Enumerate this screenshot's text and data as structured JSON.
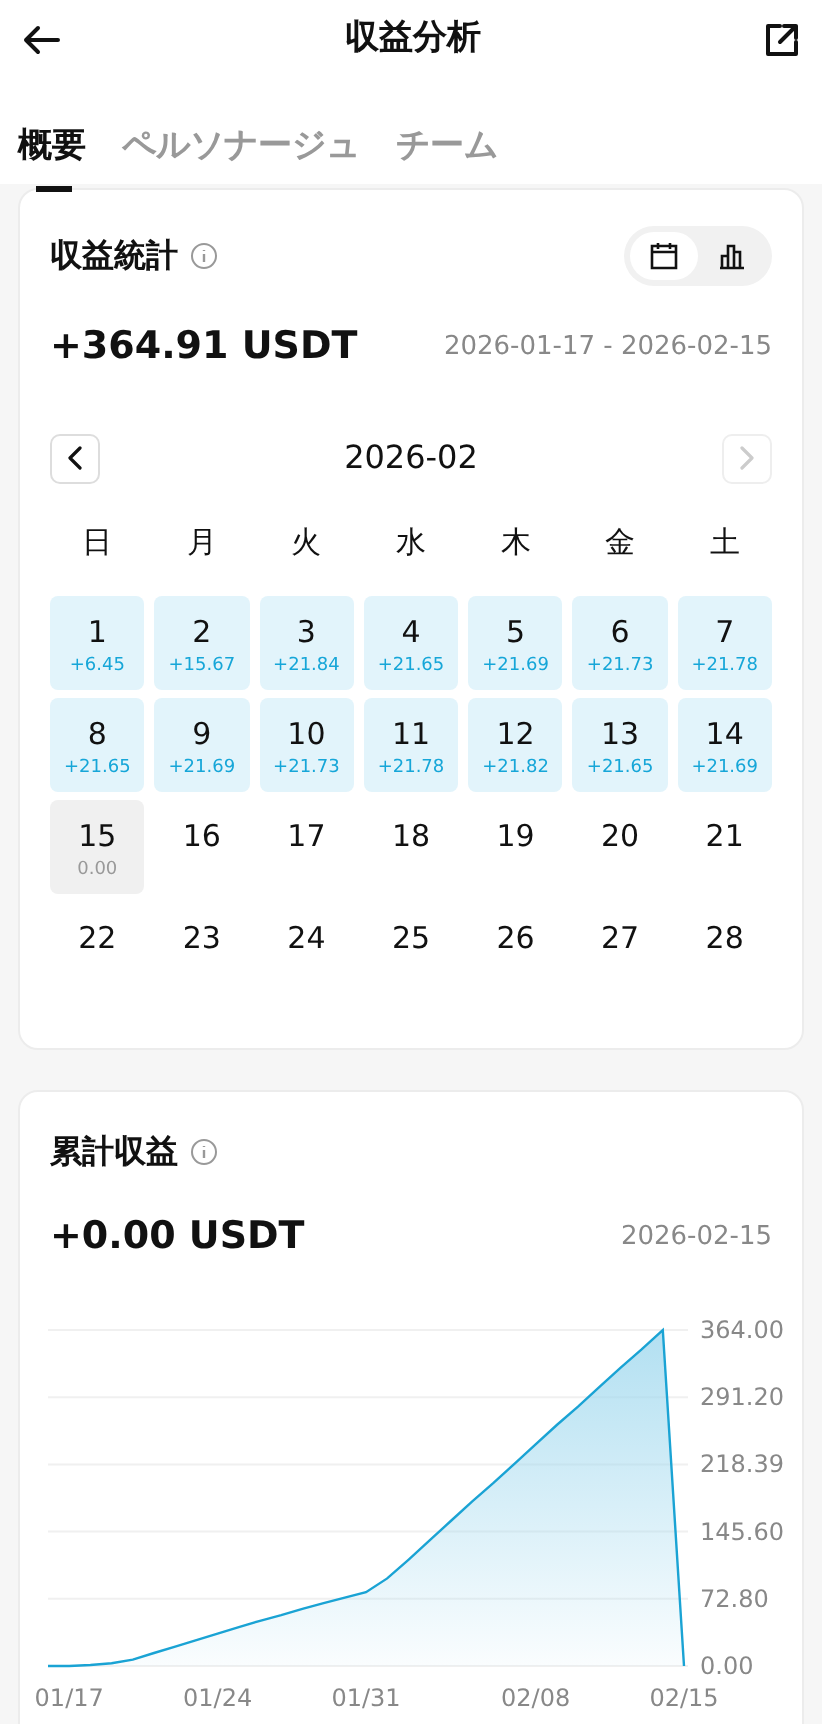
{
  "header": {
    "title": "収益分析"
  },
  "tabs": [
    {
      "label": "概要",
      "selected": true
    },
    {
      "label": "ペルソナージュ",
      "selected": false
    },
    {
      "label": "チーム",
      "selected": false
    }
  ],
  "stats": {
    "title": "収益統計",
    "view_toggle": [
      {
        "kind": "calendar",
        "selected": true
      },
      {
        "kind": "bars",
        "selected": false
      }
    ],
    "total": "+364.91 USDT",
    "range": "2026-01-17 - 2026-02-15",
    "calendar": {
      "month": "2026-02",
      "prev_disabled": false,
      "next_disabled": true,
      "weekdays": [
        "日",
        "月",
        "火",
        "水",
        "木",
        "金",
        "土"
      ],
      "weeks": [
        [
          {
            "day": "1",
            "amount": "+6.45",
            "kind": "profit"
          },
          {
            "day": "2",
            "amount": "+15.67",
            "kind": "profit"
          },
          {
            "day": "3",
            "amount": "+21.84",
            "kind": "profit"
          },
          {
            "day": "4",
            "amount": "+21.65",
            "kind": "profit"
          },
          {
            "day": "5",
            "amount": "+21.69",
            "kind": "profit"
          },
          {
            "day": "6",
            "amount": "+21.73",
            "kind": "profit"
          },
          {
            "day": "7",
            "amount": "+21.78",
            "kind": "profit"
          }
        ],
        [
          {
            "day": "8",
            "amount": "+21.65",
            "kind": "profit"
          },
          {
            "day": "9",
            "amount": "+21.69",
            "kind": "profit"
          },
          {
            "day": "10",
            "amount": "+21.73",
            "kind": "profit"
          },
          {
            "day": "11",
            "amount": "+21.78",
            "kind": "profit"
          },
          {
            "day": "12",
            "amount": "+21.82",
            "kind": "profit"
          },
          {
            "day": "13",
            "amount": "+21.65",
            "kind": "profit"
          },
          {
            "day": "14",
            "amount": "+21.69",
            "kind": "profit"
          }
        ],
        [
          {
            "day": "15",
            "amount": "0.00",
            "kind": "zero"
          },
          {
            "day": "16",
            "kind": "plain"
          },
          {
            "day": "17",
            "kind": "plain"
          },
          {
            "day": "18",
            "kind": "plain"
          },
          {
            "day": "19",
            "kind": "plain"
          },
          {
            "day": "20",
            "kind": "plain"
          },
          {
            "day": "21",
            "kind": "plain"
          }
        ],
        [
          {
            "day": "22",
            "kind": "plain"
          },
          {
            "day": "23",
            "kind": "plain"
          },
          {
            "day": "24",
            "kind": "plain"
          },
          {
            "day": "25",
            "kind": "plain"
          },
          {
            "day": "26",
            "kind": "plain"
          },
          {
            "day": "27",
            "kind": "plain"
          },
          {
            "day": "28",
            "kind": "plain"
          }
        ]
      ]
    }
  },
  "cumulative": {
    "title": "累計収益",
    "total": "+0.00 USDT",
    "date": "2026-02-15",
    "chart_data": {
      "type": "area",
      "categories": [
        null,
        "01/17",
        null,
        null,
        null,
        null,
        null,
        null,
        "01/24",
        null,
        null,
        null,
        null,
        null,
        null,
        "01/31",
        null,
        null,
        null,
        null,
        null,
        null,
        null,
        "02/08",
        null,
        null,
        null,
        null,
        null,
        null,
        "02/15"
      ],
      "grid": true,
      "series": [
        {
          "color": "#1aa3d4",
          "values": [
            0,
            0,
            1,
            3,
            7,
            14,
            21,
            28,
            35,
            42,
            49,
            55,
            62,
            68,
            74,
            80,
            95,
            115,
            136,
            157,
            178,
            198,
            219,
            240,
            261,
            281,
            302,
            323,
            343,
            364,
            0
          ]
        }
      ],
      "ylim": [
        0,
        364
      ],
      "yticks": [
        {
          "value": 364,
          "label": "364.00"
        },
        {
          "value": 291.2,
          "label": "291.20"
        },
        {
          "value": 218.39,
          "label": "218.39"
        },
        {
          "value": 145.6,
          "label": "145.60"
        },
        {
          "value": 72.8,
          "label": "72.80"
        },
        {
          "value": 0,
          "label": "0.00"
        }
      ]
    }
  }
}
